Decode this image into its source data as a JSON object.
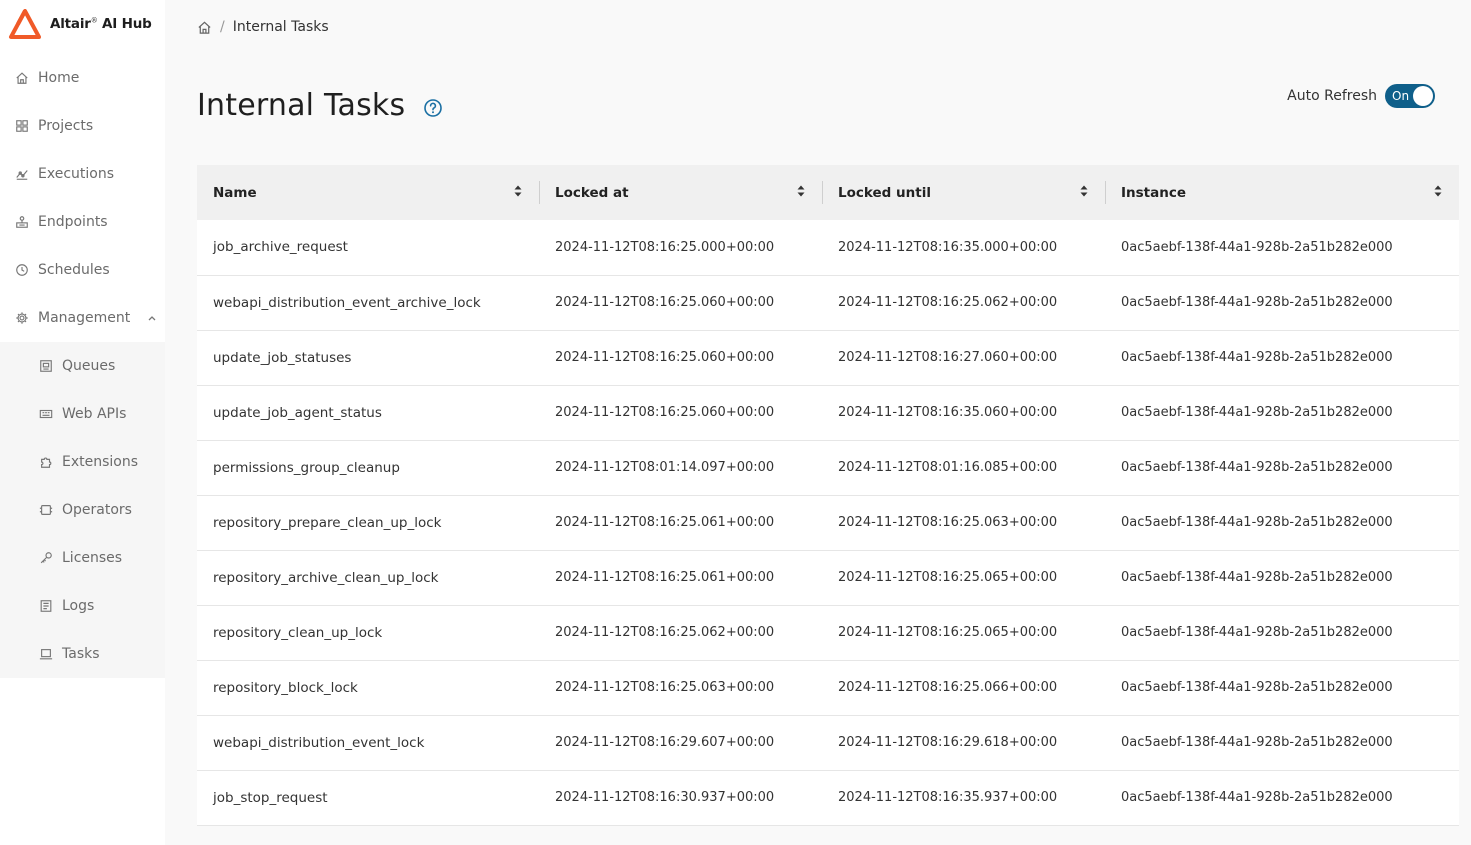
{
  "app": {
    "logo_text": "Altair",
    "logo_reg": "®",
    "logo_suffix": "AI Hub",
    "brand_color": "#f05a28"
  },
  "sidebar": {
    "items": [
      {
        "label": "Home",
        "icon": "home-icon"
      },
      {
        "label": "Projects",
        "icon": "grid-icon"
      },
      {
        "label": "Executions",
        "icon": "executions-icon"
      },
      {
        "label": "Endpoints",
        "icon": "endpoints-icon"
      },
      {
        "label": "Schedules",
        "icon": "clock-icon"
      },
      {
        "label": "Management",
        "icon": "gear-icon"
      }
    ],
    "sub_items": [
      {
        "label": "Queues",
        "icon": "queue-icon"
      },
      {
        "label": "Web APIs",
        "icon": "webapi-icon"
      },
      {
        "label": "Extensions",
        "icon": "puzzle-icon"
      },
      {
        "label": "Operators",
        "icon": "chip-icon"
      },
      {
        "label": "Licenses",
        "icon": "key-icon"
      },
      {
        "label": "Logs",
        "icon": "log-icon"
      },
      {
        "label": "Tasks",
        "icon": "laptop-icon"
      }
    ]
  },
  "breadcrumb": {
    "separator": "/",
    "current": "Internal Tasks"
  },
  "page": {
    "title": "Internal Tasks"
  },
  "auto_refresh": {
    "label": "Auto Refresh",
    "state": "On"
  },
  "table": {
    "columns": [
      "Name",
      "Locked at",
      "Locked until",
      "Instance"
    ],
    "rows": [
      [
        "job_archive_request",
        "2024-11-12T08:16:25.000+00:00",
        "2024-11-12T08:16:35.000+00:00",
        "0ac5aebf-138f-44a1-928b-2a51b282e000"
      ],
      [
        "webapi_distribution_event_archive_lock",
        "2024-11-12T08:16:25.060+00:00",
        "2024-11-12T08:16:25.062+00:00",
        "0ac5aebf-138f-44a1-928b-2a51b282e000"
      ],
      [
        "update_job_statuses",
        "2024-11-12T08:16:25.060+00:00",
        "2024-11-12T08:16:27.060+00:00",
        "0ac5aebf-138f-44a1-928b-2a51b282e000"
      ],
      [
        "update_job_agent_status",
        "2024-11-12T08:16:25.060+00:00",
        "2024-11-12T08:16:35.060+00:00",
        "0ac5aebf-138f-44a1-928b-2a51b282e000"
      ],
      [
        "permissions_group_cleanup",
        "2024-11-12T08:01:14.097+00:00",
        "2024-11-12T08:01:16.085+00:00",
        "0ac5aebf-138f-44a1-928b-2a51b282e000"
      ],
      [
        "repository_prepare_clean_up_lock",
        "2024-11-12T08:16:25.061+00:00",
        "2024-11-12T08:16:25.063+00:00",
        "0ac5aebf-138f-44a1-928b-2a51b282e000"
      ],
      [
        "repository_archive_clean_up_lock",
        "2024-11-12T08:16:25.061+00:00",
        "2024-11-12T08:16:25.065+00:00",
        "0ac5aebf-138f-44a1-928b-2a51b282e000"
      ],
      [
        "repository_clean_up_lock",
        "2024-11-12T08:16:25.062+00:00",
        "2024-11-12T08:16:25.065+00:00",
        "0ac5aebf-138f-44a1-928b-2a51b282e000"
      ],
      [
        "repository_block_lock",
        "2024-11-12T08:16:25.063+00:00",
        "2024-11-12T08:16:25.066+00:00",
        "0ac5aebf-138f-44a1-928b-2a51b282e000"
      ],
      [
        "webapi_distribution_event_lock",
        "2024-11-12T08:16:29.607+00:00",
        "2024-11-12T08:16:29.618+00:00",
        "0ac5aebf-138f-44a1-928b-2a51b282e000"
      ],
      [
        "job_stop_request",
        "2024-11-12T08:16:30.937+00:00",
        "2024-11-12T08:16:35.937+00:00",
        "0ac5aebf-138f-44a1-928b-2a51b282e000"
      ]
    ]
  }
}
